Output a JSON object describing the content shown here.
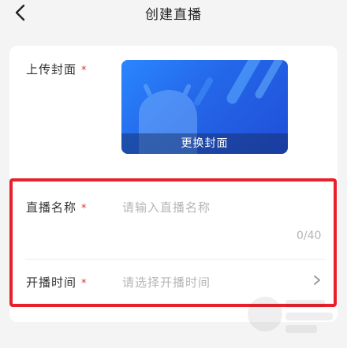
{
  "header": {
    "title": "创建直播"
  },
  "cover": {
    "label": "上传封面",
    "required_mark": "*",
    "change_label": "更换封面"
  },
  "live_name": {
    "label": "直播名称",
    "required_mark": "*",
    "placeholder": "请输入直播名称",
    "counter": "0/40"
  },
  "start_time": {
    "label": "开播时间",
    "required_mark": "*",
    "placeholder": "请选择开播时间"
  },
  "colors": {
    "accent_red": "#e0342f",
    "highlight_border": "#e8202a",
    "cover_blue": "#2466e8"
  },
  "icons": {
    "back": "chevron-left-icon",
    "picker": "chevron-right-icon"
  }
}
